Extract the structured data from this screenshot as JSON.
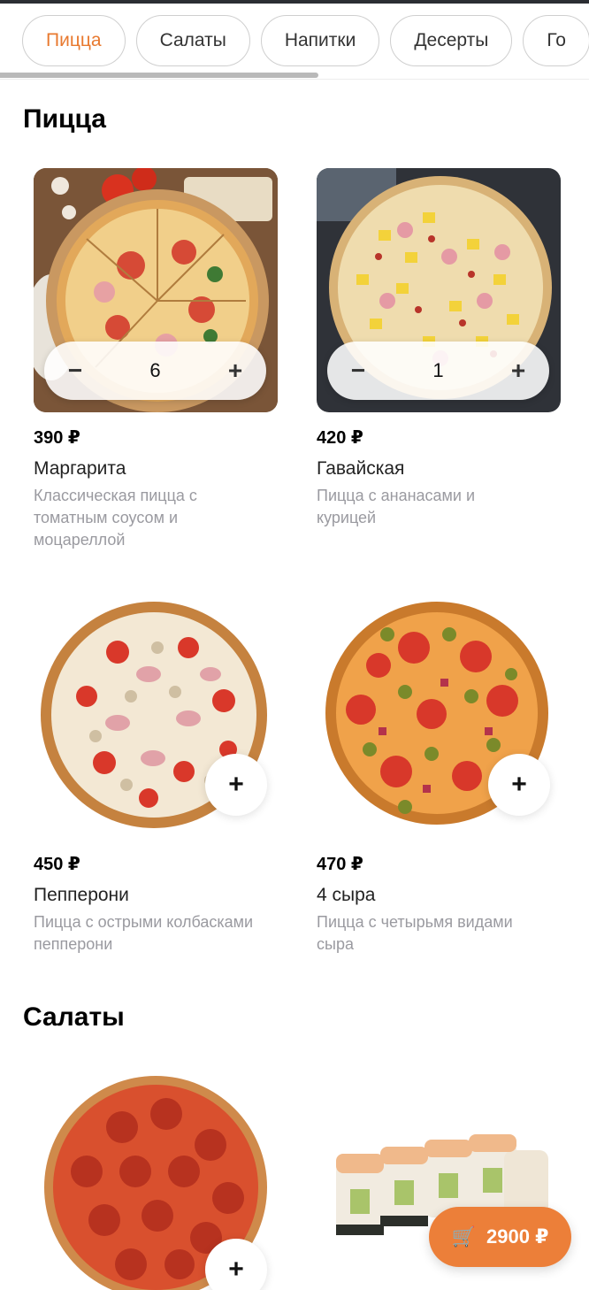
{
  "tabs": [
    {
      "label": "Пицца",
      "active": true
    },
    {
      "label": "Салаты",
      "active": false
    },
    {
      "label": "Напитки",
      "active": false
    },
    {
      "label": "Десерты",
      "active": false
    },
    {
      "label": "Го",
      "active": false
    }
  ],
  "accent_color": "#e8792f",
  "sections": [
    {
      "title": "Пицца",
      "items": [
        {
          "price": "390 ₽",
          "name": "Маргарита",
          "desc": "Классическая пицца с томатным соусом и моцареллой",
          "qty": "6",
          "image": "pizza-margarita"
        },
        {
          "price": "420 ₽",
          "name": "Гавайская",
          "desc": "Пицца с ананасами и курицей",
          "qty": "1",
          "image": "pizza-hawaiian"
        },
        {
          "price": "450 ₽",
          "name": "Пепперони",
          "desc": "Пицца с острыми колбасками пепперони",
          "image": "pizza-pepperoni"
        },
        {
          "price": "470 ₽",
          "name": "4 сыра",
          "desc": "Пицца с четырьмя видами сыра",
          "image": "pizza-four-cheese"
        }
      ]
    },
    {
      "title": "Салаты",
      "items": [
        {
          "image": "pizza-pepperoni-full"
        },
        {
          "image": "sushi-rolls"
        }
      ]
    }
  ],
  "stepper": {
    "minus": "−",
    "plus": "+"
  },
  "add_label": "+",
  "cart": {
    "icon": "cart-icon",
    "glyph": "🛒",
    "total": "2900 ₽"
  }
}
